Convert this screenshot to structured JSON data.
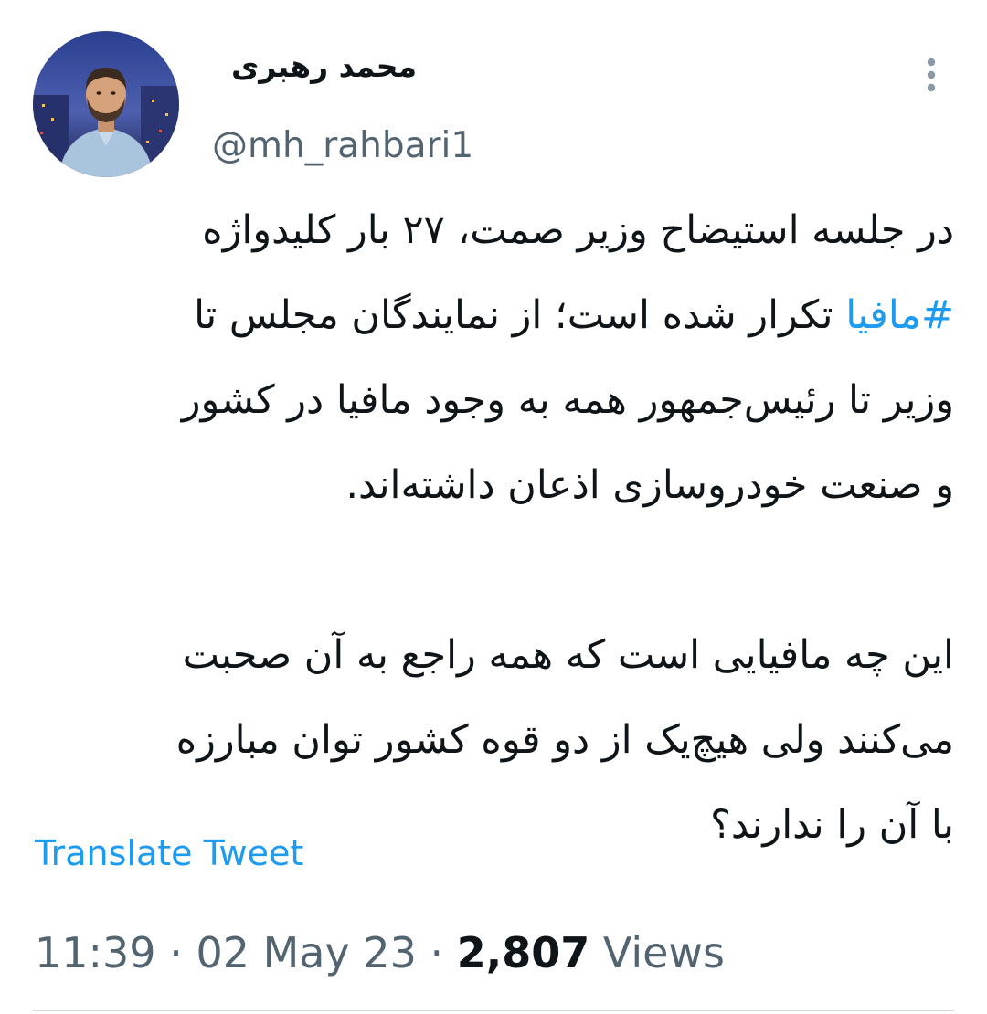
{
  "tweet": {
    "author": {
      "display_name": "محمد رهبری",
      "handle": "@mh_rahbari1",
      "avatar_icon": "profile-photo"
    },
    "menu_icon": "more-vertical-icon",
    "text_lines_p1": [
      "در جلسه استیضاح وزیر صمت، ۲۷ بار کلیدواژه",
      "تکرار شده است؛ از نمایندگان مجلس تا",
      "وزیر تا رئیس‌جمهور همه به وجود مافیا در کشور",
      "و صنعت خودروسازی اذعان داشته‌اند."
    ],
    "hashtag": "#مافیا",
    "text_lines_p2": [
      "این چه مافیایی است که همه راجع به آن صحبت",
      "می‌کنند ولی هیچ‌یک از دو قوه کشور توان مبارزه",
      "با آن را ندارند؟"
    ],
    "translate_label": "Translate Tweet",
    "time": "11:39",
    "date": "02 May 23",
    "separator": "·",
    "views_count": "2,807",
    "views_label": "Views",
    "colors": {
      "link": "#1d9bf0",
      "secondary": "#536471",
      "text": "#0f1419"
    }
  }
}
